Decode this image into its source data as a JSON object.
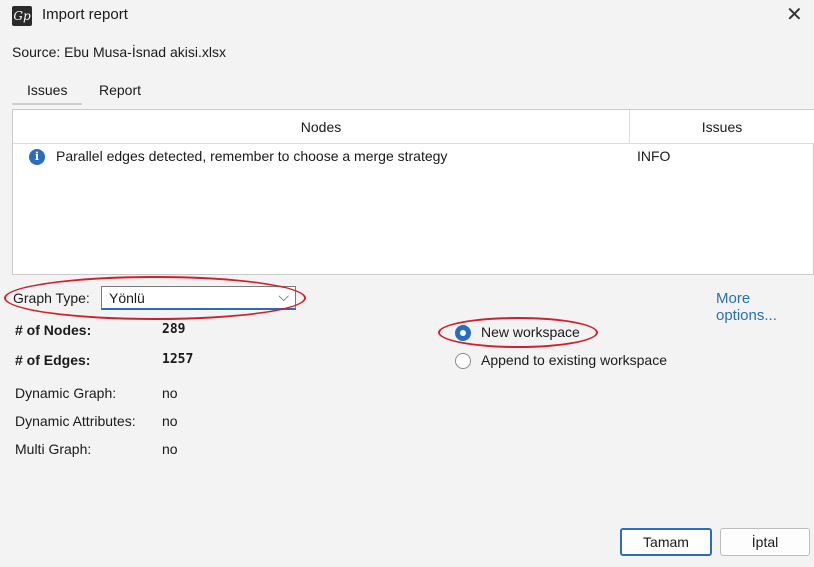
{
  "window": {
    "title": "Import report",
    "close_glyph": "✕",
    "icon_glyph": "Gp"
  },
  "source": "Source: Ebu Musa-İsnad akisi.xlsx",
  "tabs": [
    {
      "label": "Issues"
    },
    {
      "label": "Report"
    }
  ],
  "table": {
    "columns": [
      "Nodes",
      "Issues"
    ],
    "rows": [
      {
        "message": "Parallel edges detected, remember to choose a merge strategy",
        "level": "INFO",
        "icon": "info-icon"
      }
    ]
  },
  "graph_type": {
    "label": "Graph Type:",
    "value": "Yönlü"
  },
  "more_options": "More options...",
  "stats": [
    {
      "label": "# of Nodes:",
      "value": "289"
    },
    {
      "label": "# of Edges:",
      "value": "1257"
    },
    {
      "label": "Dynamic Graph:",
      "value": "no"
    },
    {
      "label": "Dynamic Attributes:",
      "value": "no"
    },
    {
      "label": "Multi Graph:",
      "value": "no"
    }
  ],
  "workspace_options": [
    {
      "label": "New workspace",
      "selected": true
    },
    {
      "label": "Append to existing workspace",
      "selected": false
    }
  ],
  "buttons": {
    "ok": "Tamam",
    "cancel": "İptal"
  },
  "colors": {
    "accent": "#2a6ebb",
    "annotation": "#d21f2a"
  }
}
